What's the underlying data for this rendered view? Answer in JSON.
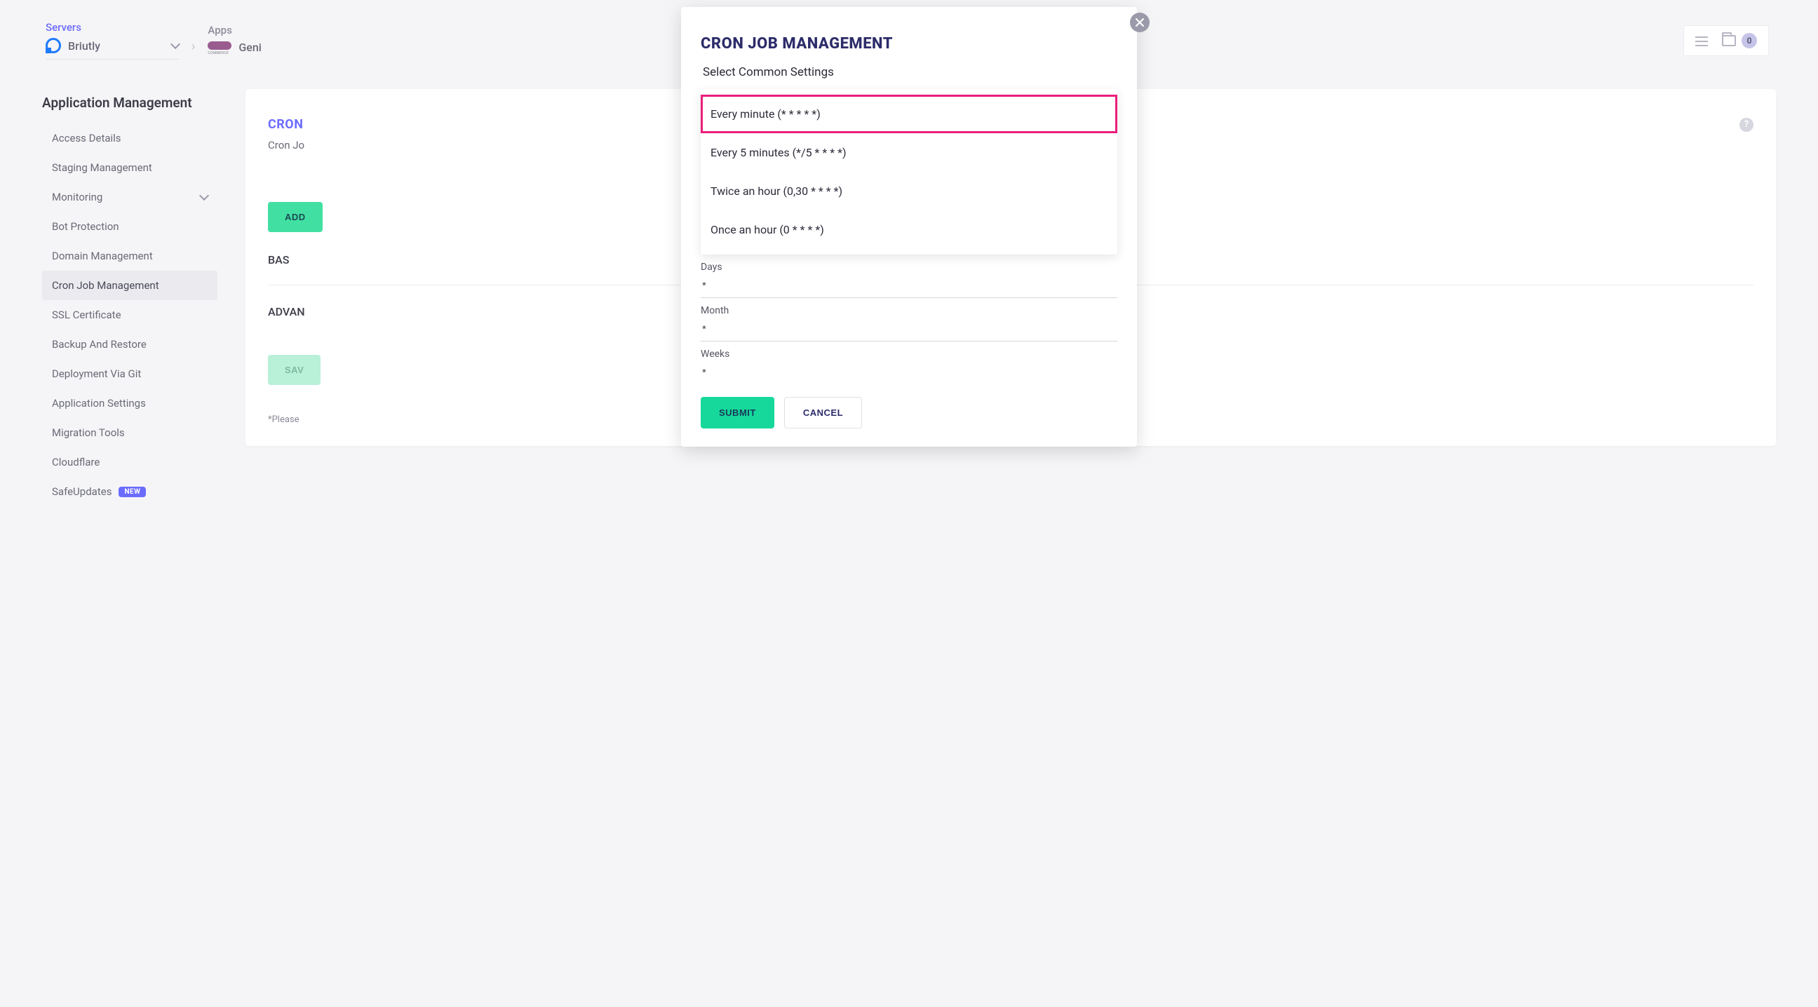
{
  "breadcrumb": {
    "servers_label": "Servers",
    "server_name": "Briutly",
    "apps_label": "Apps",
    "app_name": "Geni"
  },
  "topright": {
    "count": "0"
  },
  "sidebar": {
    "title": "Application Management",
    "items": [
      {
        "label": "Access Details"
      },
      {
        "label": "Staging Management"
      },
      {
        "label": "Monitoring",
        "expandable": true
      },
      {
        "label": "Bot Protection"
      },
      {
        "label": "Domain Management"
      },
      {
        "label": "Cron Job Management",
        "active": true
      },
      {
        "label": "SSL Certificate"
      },
      {
        "label": "Backup And Restore"
      },
      {
        "label": "Deployment Via Git"
      },
      {
        "label": "Application Settings"
      },
      {
        "label": "Migration Tools"
      },
      {
        "label": "Cloudflare"
      },
      {
        "label": "SafeUpdates",
        "badge": "NEW"
      }
    ]
  },
  "content": {
    "title": "CRON",
    "subtitle": "Cron Jo",
    "add_button": "ADD",
    "basic_label": "BAS",
    "advanced_label": "ADVAN",
    "save_button": "SAV",
    "note": "*Please "
  },
  "modal": {
    "title": "CRON JOB MANAGEMENT",
    "select_label": "Select Common Settings",
    "options": [
      "Every minute (* * * * *)",
      "Every 5 minutes (*/5 * * * *)",
      "Twice an hour (0,30 * * * *)",
      "Once an hour (0 * * * *)"
    ],
    "fields": {
      "days_label": "Days",
      "days_value": "*",
      "month_label": "Month",
      "month_value": "*",
      "weeks_label": "Weeks",
      "weeks_value": "*"
    },
    "submit": "SUBMIT",
    "cancel": "CANCEL"
  }
}
